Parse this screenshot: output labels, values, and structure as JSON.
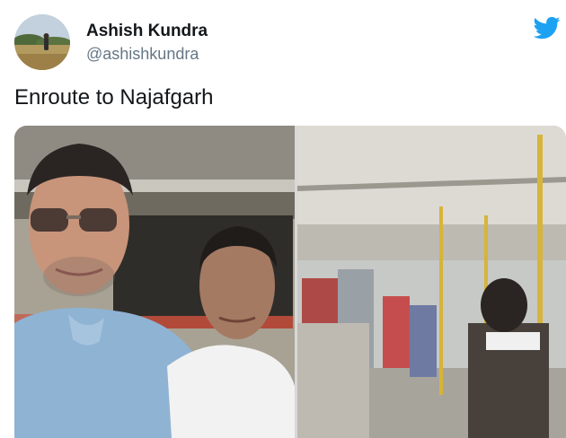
{
  "tweet": {
    "author_name": "Ashish Kundra",
    "author_handle": "@ashishkundra",
    "text": "Enroute to Najafgarh"
  },
  "icons": {
    "brand": "twitter-bird-icon",
    "brand_color": "#1da1f2"
  },
  "media": {
    "count": 2
  }
}
